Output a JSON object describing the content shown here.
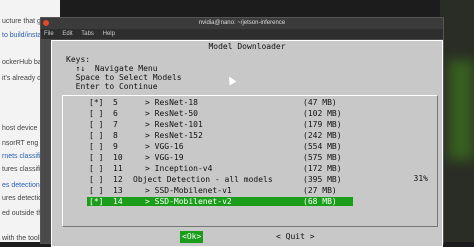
{
  "background_page": {
    "lines": [
      {
        "text": "ucture that ge",
        "link": false
      },
      {
        "text": "to build/instal",
        "link": true
      },
      {
        "text": "ockerHub ba",
        "link": false
      },
      {
        "text": "it's already do",
        "link": false
      },
      {
        "text": "host device",
        "link": false
      },
      {
        "text": "nsorRT eng",
        "link": false
      },
      {
        "text": "rnets classifica",
        "link": true
      },
      {
        "text": "tures classifi",
        "link": false
      },
      {
        "text": "es detection t",
        "link": true
      },
      {
        "text": "ures detection",
        "link": false
      },
      {
        "text": "ed outside the",
        "link": false
      },
      {
        "text": "with the toolkit",
        "link": false
      }
    ]
  },
  "terminal": {
    "title": "nvidia@nano: ~/jetson-inference",
    "menu": [
      "File",
      "Edit",
      "Tabs",
      "Help"
    ]
  },
  "dialog": {
    "title": "Model Downloader",
    "keys_lines": [
      "Keys:",
      "  ↑↓  Navigate Menu",
      "  Space to Select Models",
      "  Enter to Continue"
    ],
    "rows": [
      {
        "chk": "[*]",
        "num": "5",
        "name": "> ResNet-18",
        "size": "(47 MB)",
        "selected": false
      },
      {
        "chk": "[ ]",
        "num": "6",
        "name": "> ResNet-50",
        "size": "(102 MB)",
        "selected": false
      },
      {
        "chk": "[ ]",
        "num": "7",
        "name": "> ResNet-101",
        "size": "(179 MB)",
        "selected": false
      },
      {
        "chk": "[ ]",
        "num": "8",
        "name": "> ResNet-152",
        "size": "(242 MB)",
        "selected": false
      },
      {
        "chk": "[ ]",
        "num": "9",
        "name": "> VGG-16",
        "size": "(554 MB)",
        "selected": false
      },
      {
        "chk": "[ ]",
        "num": "10",
        "name": "> VGG-19",
        "size": "(575 MB)",
        "selected": false
      },
      {
        "chk": "[ ]",
        "num": "11",
        "name": "> Inception-v4",
        "size": "(172 MB)",
        "selected": false
      },
      {
        "chk": "[ ]",
        "num": "12",
        "name": "Object Detection - all models",
        "size": "(395 MB)",
        "selected": false,
        "category": true
      },
      {
        "chk": "[ ]",
        "num": "13",
        "name": "> SSD-Mobilenet-v1",
        "size": "(27 MB)",
        "selected": false
      },
      {
        "chk": "[*]",
        "num": "14",
        "name": "> SSD-Mobilenet-v2",
        "size": "(68 MB)",
        "selected": true
      }
    ],
    "scroll_percent": "31%",
    "ok_label": "<Ok>",
    "quit_label": "< Quit >"
  }
}
